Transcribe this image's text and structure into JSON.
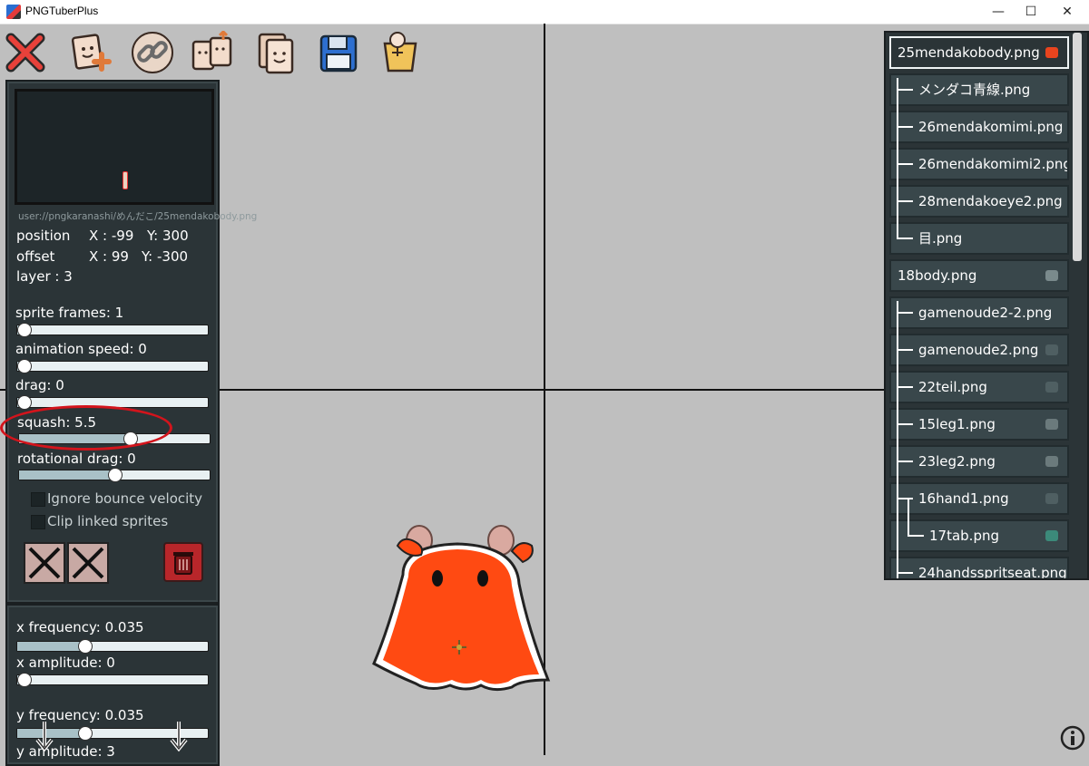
{
  "window": {
    "title": "PNGTuberPlus",
    "controls": {
      "minimize": "—",
      "maximize": "☐",
      "close": "✕"
    }
  },
  "toolbar": {
    "items": [
      {
        "icon": "close-x-icon"
      },
      {
        "icon": "add-sprite-icon"
      },
      {
        "icon": "link-icon"
      },
      {
        "icon": "swap-sprites-icon"
      },
      {
        "icon": "duplicate-icon"
      },
      {
        "icon": "save-icon"
      },
      {
        "icon": "costume-icon"
      }
    ]
  },
  "sprite_panel": {
    "path": "user://pngkaranashi/めんだこ/25mendakobody.png",
    "position_label": "position",
    "position_x": "X : -99",
    "position_y": "Y: 300",
    "offset_label": "offset",
    "offset_x": "X : 99",
    "offset_y": "Y: -300",
    "layer": "layer : 3",
    "sliders": [
      {
        "label": "sprite frames: 1",
        "value": 0.0
      },
      {
        "label": "animation speed: 0",
        "value": 0.0
      },
      {
        "label": "drag: 0",
        "value": 0.0
      },
      {
        "label": "squash: 5.5",
        "value": 0.58
      },
      {
        "label": "rotational drag: 0",
        "value": 0.5
      }
    ],
    "checkboxes": [
      {
        "label": "Ignore bounce velocity",
        "checked": false
      },
      {
        "label": "Clip linked sprites",
        "checked": false
      }
    ]
  },
  "wobble_panel": {
    "sliders": [
      {
        "label": "x frequency: 0.035",
        "value": 0.35
      },
      {
        "label": "x amplitude: 0",
        "value": 0.0
      },
      {
        "label": "y frequency: 0.035",
        "value": 0.35
      },
      {
        "label": "y amplitude: 3",
        "value": 0.1
      }
    ]
  },
  "layers": {
    "items": [
      {
        "name": "25mendakobody.png",
        "selected": true,
        "thumb": "#e8441e"
      },
      {
        "name": "メンダコ青線.png",
        "thumb": ""
      },
      {
        "name": "26mendakomimi.png",
        "thumb": ""
      },
      {
        "name": "26mendakomimi2.png",
        "thumb": ""
      },
      {
        "name": "28mendakoeye2.png",
        "thumb": ""
      },
      {
        "name": "目.png",
        "thumb": ""
      },
      {
        "name": "18body.png",
        "thumb": "#7a8a8c"
      },
      {
        "name": "gamenoude2-2.png",
        "thumb": ""
      },
      {
        "name": "gamenoude2.png",
        "thumb": "#4f5f62"
      },
      {
        "name": "22teil.png",
        "thumb": "#4f5f62"
      },
      {
        "name": "15leg1.png",
        "thumb": "#6b7a7c"
      },
      {
        "name": "23leg2.png",
        "thumb": "#6b7a7c"
      },
      {
        "name": "16hand1.png",
        "thumb": "#4f5f62"
      },
      {
        "name": "17tab.png",
        "thumb": "#3c8a7a"
      },
      {
        "name": "24handsspritseat.png",
        "thumb": ""
      }
    ]
  },
  "colors": {
    "canvas_bg": "#bfbfbf",
    "panel_bg": "#2b3437",
    "highlight_ring": "#d3141c",
    "character_body": "#ff4a12"
  }
}
